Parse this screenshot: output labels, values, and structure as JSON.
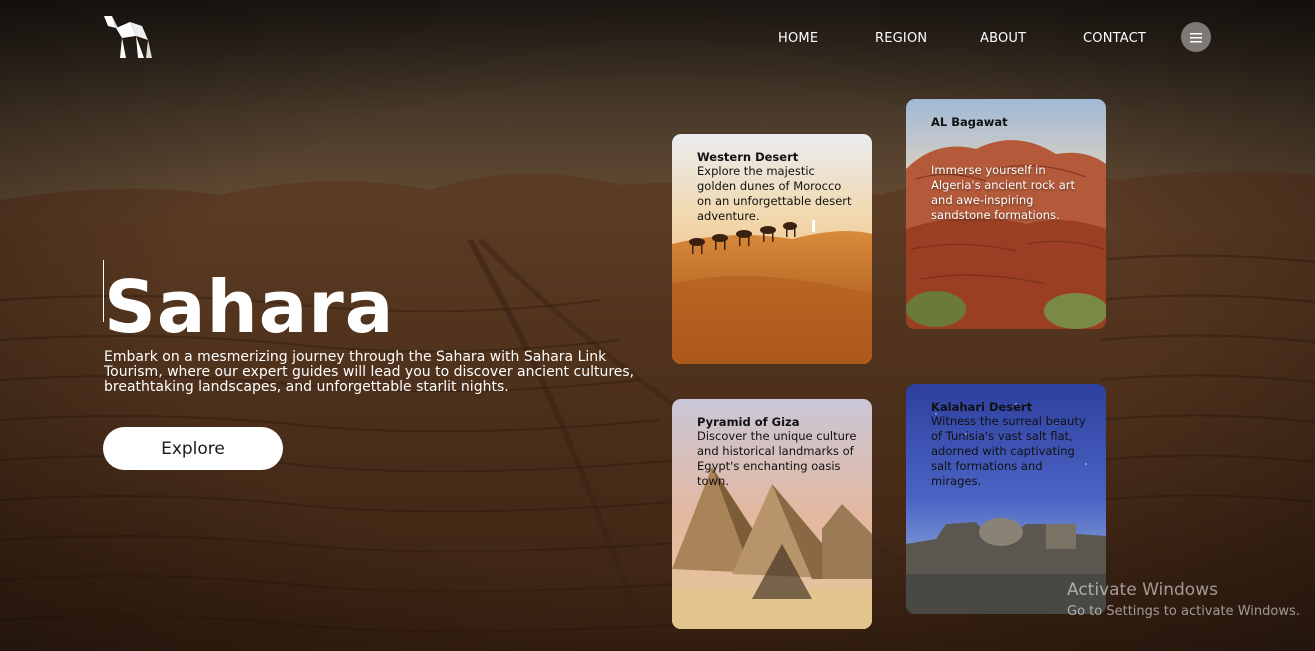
{
  "nav": {
    "items": [
      {
        "label": "HOME"
      },
      {
        "label": "REGION"
      },
      {
        "label": "ABOUT"
      },
      {
        "label": "CONTACT"
      }
    ],
    "menu_icon": "hamburger-icon",
    "logo_icon": "camel-logo-icon"
  },
  "hero": {
    "title": "Sahara",
    "description": "Embark on a mesmerizing journey through the Sahara with Sahara Link Tourism, where our expert guides will lead you to discover ancient cultures, breathtaking landscapes, and unforgettable starlit nights.",
    "button_label": "Explore"
  },
  "cards": [
    {
      "title": "Western Desert",
      "description": "Explore the majestic golden dunes of Morocco on an unforgettable desert adventure."
    },
    {
      "title": "AL Bagawat",
      "description": "Immerse yourself in Algeria's ancient rock art and awe-inspiring sandstone formations."
    },
    {
      "title": "Pyramid of Giza",
      "description": "Discover the unique culture and historical landmarks of Egypt's enchanting oasis town."
    },
    {
      "title": "Kalahari Desert",
      "description": "Witness the surreal beauty of Tunisia's vast salt flat, adorned with captivating salt formations and mirages."
    }
  ],
  "watermark": {
    "title": "Activate Windows",
    "subtitle": "Go to Settings to activate Windows."
  },
  "colors": {
    "accent": "#ffffff",
    "background": "#3a2416"
  }
}
